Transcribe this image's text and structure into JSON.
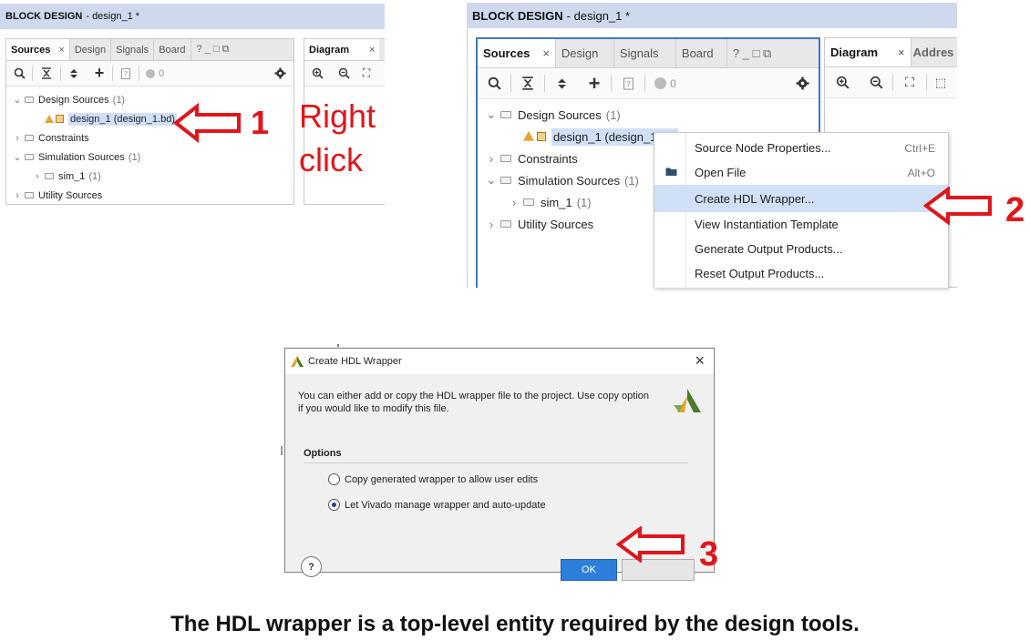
{
  "panel1": {
    "title": "BLOCK DESIGN",
    "subtitle": "- design_1 *",
    "tabs": [
      "Sources",
      "Design",
      "Signals",
      "Board"
    ],
    "tab_close": "×",
    "tab_controls": "? _ □ ⧉",
    "status_count": "0",
    "diagram_tab": "Diagram",
    "tree": {
      "design_sources": "Design Sources",
      "design_sources_count": "(1)",
      "design_1": "design_1 (design_1.bd)",
      "constraints": "Constraints",
      "simulation_sources": "Simulation Sources",
      "simulation_sources_count": "(1)",
      "sim_1": "sim_1",
      "sim_1_count": "(1)",
      "utility_sources": "Utility Sources"
    }
  },
  "annotation1": {
    "number": "1",
    "line1": "Right",
    "line2": "click"
  },
  "panel2": {
    "title": "BLOCK DESIGN",
    "subtitle": "- design_1 *",
    "tabs": [
      "Sources",
      "Design",
      "Signals",
      "Board"
    ],
    "tab_close": "×",
    "tab_controls": "? _ □ ⧉",
    "status_count": "0",
    "diagram_tab": "Diagram",
    "address_tab": "Addres",
    "tree": {
      "design_sources": "Design Sources",
      "design_sources_count": "(1)",
      "design_1": "design_1 (design_1",
      "constraints": "Constraints",
      "simulation_sources": "Simulation Sources",
      "simulation_sources_count": "(1)",
      "sim_1": "sim_1",
      "sim_1_count": "(1)",
      "utility_sources": "Utility Sources"
    },
    "menu": [
      {
        "label": "Source Node Properties...",
        "shortcut": "Ctrl+E"
      },
      {
        "label": "Open File",
        "shortcut": "Alt+O"
      },
      {
        "label": "Create HDL Wrapper...",
        "shortcut": ""
      },
      {
        "label": "View Instantiation Template",
        "shortcut": ""
      },
      {
        "label": "Generate Output Products...",
        "shortcut": ""
      },
      {
        "label": "Reset Output Products...",
        "shortcut": ""
      }
    ]
  },
  "annotation2": {
    "number": "2"
  },
  "dialog": {
    "title": "Create HDL Wrapper",
    "close": "×",
    "message_line1": "You can either add or copy the HDL wrapper file to the project. Use copy option",
    "message_line2": "if you would like to modify this file.",
    "options_heading": "Options",
    "option1": "Copy generated wrapper to allow user edits",
    "option2": "Let Vivado manage wrapper and auto-update",
    "selected_option": 2,
    "help": "?",
    "ok": "OK"
  },
  "annotation3": {
    "number": "3"
  },
  "caption": "The HDL wrapper is a top-level entity required by the design tools.",
  "colors": {
    "accent_red": "#e0161b",
    "title_bar": "#cfd9ee",
    "selection": "#cfe0f7",
    "ok_button": "#2e7fdc"
  }
}
